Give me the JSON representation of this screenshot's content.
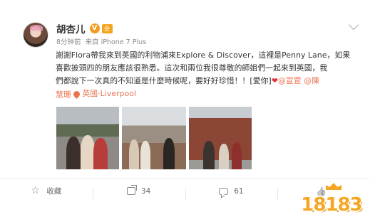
{
  "post": {
    "author": "胡杏儿",
    "verified_badge": "V",
    "member_badge": "会",
    "time": "8分钟前",
    "source": "来自 iPhone 7 Plus",
    "content": {
      "line1": "謝謝Flora帶我來到英國的利物浦來Explore & Discover，這裡是Penny Lane，如果",
      "line2": "喜歡披頭四的朋友應該很熟悉。這次和兩位我很尊敬的師姐們一起來到英國，我",
      "line3_part1": "們都說下一次真的不知道是什麼時候呢，要好好珍惜！！[愛你]",
      "heart": "❤",
      "mention1": "@宣萱",
      "mention2_part1": "@陳",
      "mention2_part2": "慧珊",
      "location": "英國·Liverpool"
    },
    "photos": [
      "photo-1",
      "photo-2",
      "photo-3"
    ]
  },
  "actions": {
    "favorite_label": "收藏",
    "repost_count": "34",
    "comment_count": "61",
    "like_count": ""
  },
  "watermark": {
    "text": "18183"
  },
  "icons": {
    "chevron": "chevron-down-icon",
    "favorite": "star-icon",
    "repost": "share-icon",
    "comment": "comment-icon",
    "like": "thumbs-up-icon",
    "location": "location-pin-icon"
  },
  "colors": {
    "link": "#eb7350",
    "verified": "#f39b1f",
    "heart": "#e0313a",
    "watermark": "#f6a623"
  }
}
